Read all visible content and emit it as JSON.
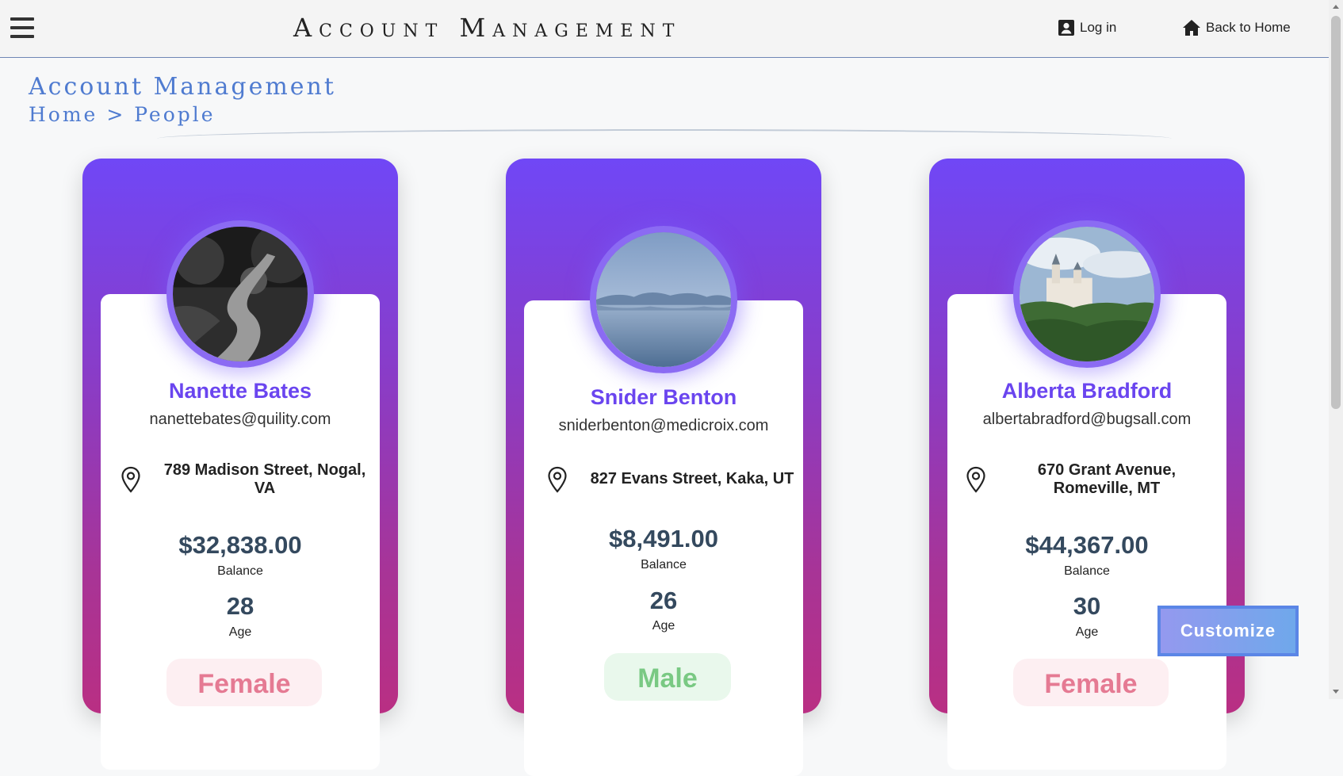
{
  "header": {
    "title": "Account Management",
    "login_label": "Log in",
    "home_label": "Back to Home"
  },
  "page": {
    "heading": "Account Management",
    "breadcrumb": {
      "home": "Home",
      "separator": ">",
      "current": "People"
    }
  },
  "people": [
    {
      "name": "Nanette Bates",
      "email": "nanettebates@quility.com",
      "address_line1": "789 Madison Street, Nogal,",
      "address_line2": "VA",
      "balance": "$32,838.00",
      "balance_label": "Balance",
      "age": "28",
      "age_label": "Age",
      "gender": "Female"
    },
    {
      "name": "Snider Benton",
      "email": "sniderbenton@medicroix.com",
      "address_line1": "827 Evans Street, Kaka, UT",
      "address_line2": "",
      "balance": "$8,491.00",
      "balance_label": "Balance",
      "age": "26",
      "age_label": "Age",
      "gender": "Male"
    },
    {
      "name": "Alberta Bradford",
      "email": "albertabradford@bugsall.com",
      "address_line1": "670 Grant Avenue,",
      "address_line2": "Romeville, MT",
      "balance": "$44,367.00",
      "balance_label": "Balance",
      "age": "30",
      "age_label": "Age",
      "gender": "Female"
    }
  ],
  "customize_label": "Customize",
  "icons": {
    "menu": "hamburger-menu-icon",
    "login": "account-box-icon",
    "home": "home-icon",
    "location": "location-pin-icon"
  },
  "colors": {
    "accent": "#6a45ef",
    "card_gradient_top": "#7047f6",
    "card_gradient_bottom": "#b92f83",
    "heading_blue": "#4f7bd0",
    "female_text": "#e57a93",
    "male_text": "#79c983"
  }
}
